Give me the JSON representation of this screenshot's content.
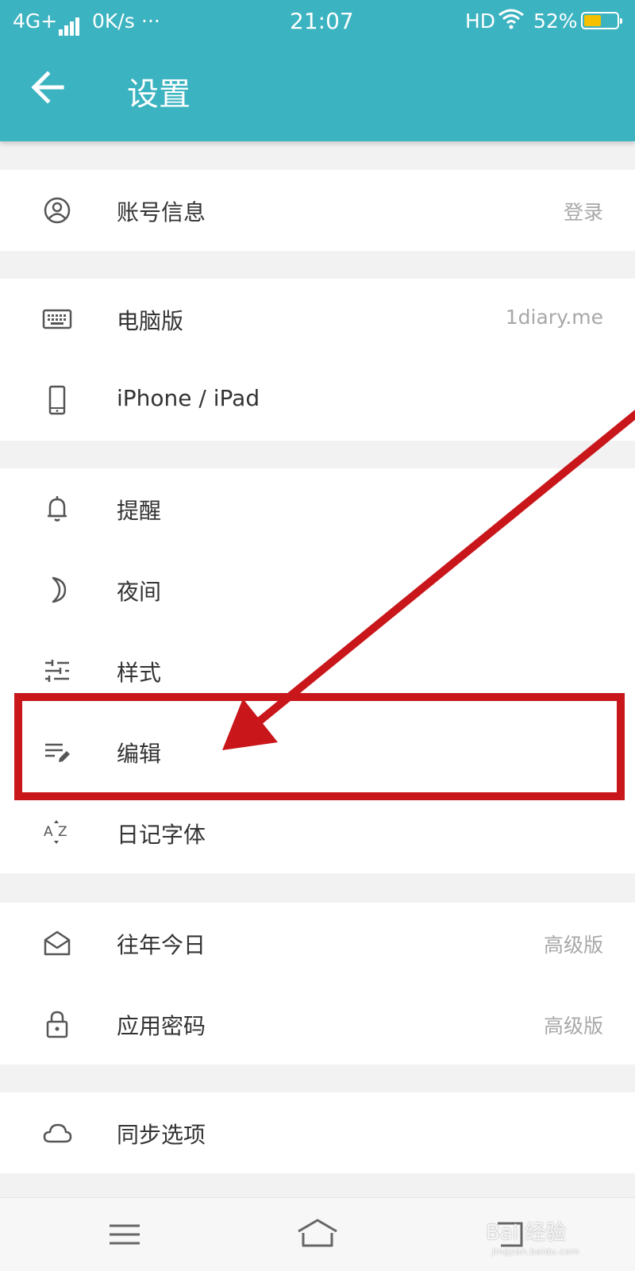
{
  "status_bar": {
    "network": "4G+",
    "speed": "0K/s",
    "more": "···",
    "time": "21:07",
    "hd": "HD",
    "battery_text": "52%",
    "battery_level": 0.52
  },
  "toolbar": {
    "title": "设置",
    "back_icon": "arrow-left-icon"
  },
  "groups": [
    {
      "items": [
        {
          "label": "账号信息",
          "value": "登录",
          "icon": "account-circle-icon"
        }
      ]
    },
    {
      "items": [
        {
          "label": "电脑版",
          "value": "1diary.me",
          "icon": "keyboard-icon"
        },
        {
          "label": "iPhone / iPad",
          "value": "",
          "icon": "phone-icon"
        }
      ]
    },
    {
      "items": [
        {
          "label": "提醒",
          "value": "",
          "icon": "bell-icon"
        },
        {
          "label": "夜间",
          "value": "",
          "icon": "moon-icon"
        },
        {
          "label": "样式",
          "value": "",
          "icon": "sliders-icon"
        },
        {
          "label": "编辑",
          "value": "",
          "icon": "edit-note-icon"
        },
        {
          "label": "日记字体",
          "value": "",
          "icon": "font-size-icon"
        }
      ]
    },
    {
      "items": [
        {
          "label": "往年今日",
          "value": "高级版",
          "icon": "envelope-open-icon"
        },
        {
          "label": "应用密码",
          "value": "高级版",
          "icon": "lock-icon"
        }
      ]
    },
    {
      "items": [
        {
          "label": "同步选项",
          "value": "",
          "icon": "cloud-icon"
        }
      ]
    }
  ],
  "nav_bar": {
    "buttons": [
      "menu-icon",
      "home-icon",
      "back-icon"
    ]
  },
  "watermark": {
    "main": "Bai 经验",
    "sub": "jingyan.baidu.com"
  },
  "colors": {
    "header": "#3cb3c1",
    "annotation": "#c8161a",
    "battery": "#f5c000"
  }
}
